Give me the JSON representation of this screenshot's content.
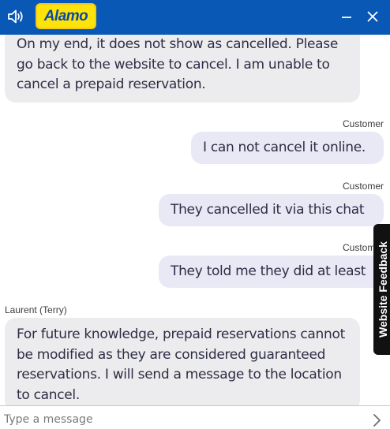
{
  "header": {
    "logo_text": "Alamo",
    "bar_color": "#0a58b5",
    "logo_color": "#fde30a",
    "icons": [
      "speaker-icon",
      "minimize-icon",
      "close-icon"
    ]
  },
  "messages": [
    {
      "role": "agent",
      "text": "On my end, it does not show as cancelled. Please go back to the website to cancel. I am unable to cancel a prepaid reservation."
    },
    {
      "role": "customer",
      "sender": "Customer",
      "text": "I can not cancel it online."
    },
    {
      "role": "customer",
      "sender": "Customer",
      "text": "They cancelled it via this chat"
    },
    {
      "role": "customer",
      "sender": "Customer",
      "text": "They told me they did at least"
    },
    {
      "role": "agent",
      "sender": "Laurent (Terry)",
      "text": "For future knowledge, prepaid reservations cannot be modified as they are considered guaranteed reservations. I will send a message to the location to cancel."
    }
  ],
  "feedback_tab": {
    "label": "Website Feedback"
  },
  "composer": {
    "placeholder": "Type a message",
    "send_icon": "chevron-right-icon"
  }
}
